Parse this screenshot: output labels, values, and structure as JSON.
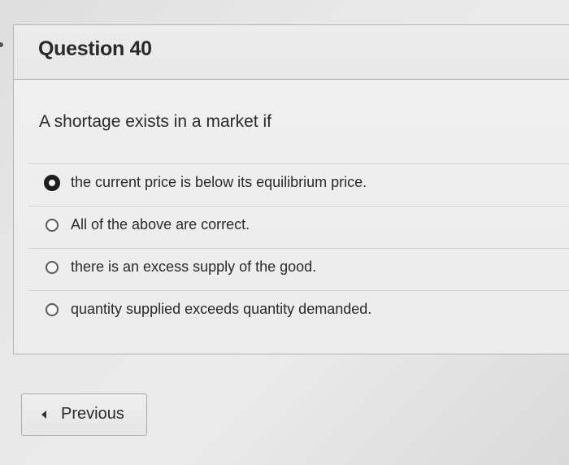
{
  "question": {
    "title": "Question 40",
    "text": "A shortage exists in a market if",
    "options": [
      {
        "label": "the current price is below its equilibrium price.",
        "selected": true
      },
      {
        "label": "All of the above are correct.",
        "selected": false
      },
      {
        "label": "there is an excess supply of the good.",
        "selected": false
      },
      {
        "label": "quantity supplied exceeds quantity demanded.",
        "selected": false
      }
    ]
  },
  "navigation": {
    "previous_label": "Previous",
    "previous_icon": "caret-left-icon"
  }
}
